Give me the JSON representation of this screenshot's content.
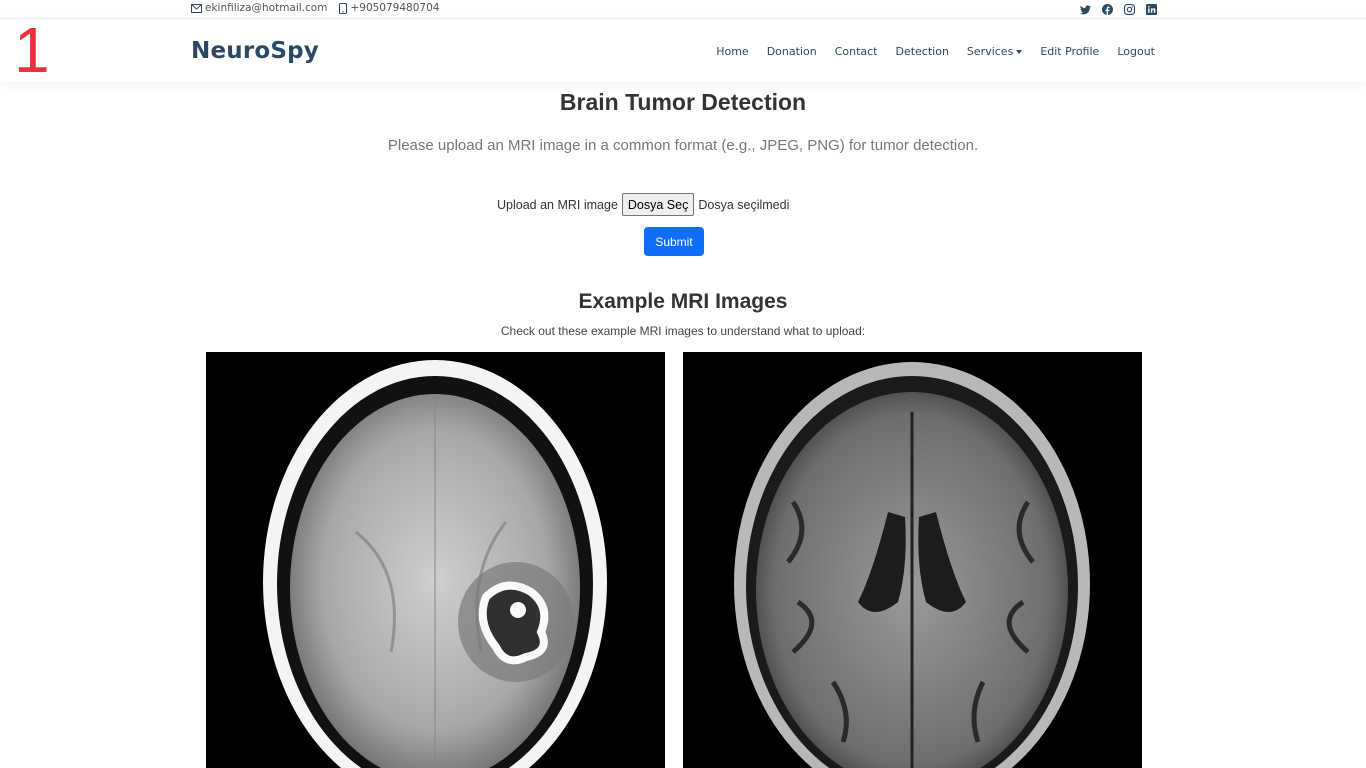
{
  "marker": "1",
  "topbar": {
    "email": "ekinfiliza@hotmail.com",
    "phone": "+905079480704",
    "social": [
      "twitter-icon",
      "facebook-icon",
      "instagram-icon",
      "linkedin-icon"
    ]
  },
  "brand": "NeuroSpy",
  "nav": {
    "home": "Home",
    "donation": "Donation",
    "contact": "Contact",
    "detection": "Detection",
    "services": "Services",
    "edit_profile": "Edit Profile",
    "logout": "Logout"
  },
  "main": {
    "title": "Brain Tumor Detection",
    "subtitle": "Please upload an MRI image in a common format (e.g., JPEG, PNG) for tumor detection.",
    "upload_label": "Upload an MRI image",
    "file_button": "Dosya Seç",
    "file_status": "Dosya seçilmedi",
    "submit": "Submit"
  },
  "examples": {
    "title": "Example MRI Images",
    "subtitle": "Check out these example MRI images to understand what to upload:"
  },
  "colors": {
    "brand": "#2c4964",
    "primary": "#0d6efd",
    "marker": "#e8323a"
  }
}
